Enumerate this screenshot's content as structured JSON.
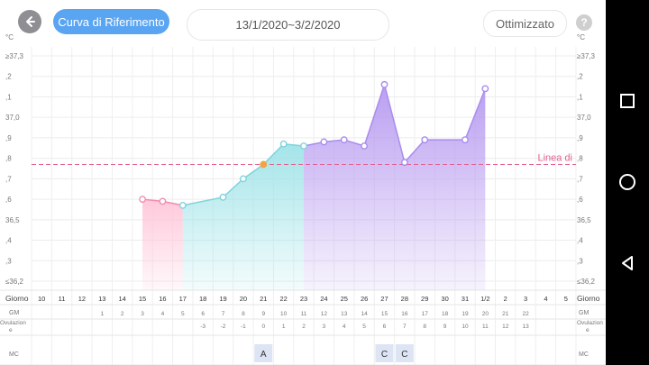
{
  "header": {
    "reference_curve_label": "Curva di Riferimento",
    "date_range": "13/1/2020~3/2/2020",
    "optimized_label": "Ottimizzato",
    "help_label": "?"
  },
  "colors": {
    "accent": "#5aa5f2",
    "follicular_fill": "#9fe3e8",
    "menses_fill": "#ffc6d9",
    "luteal_fill": "#b79af0",
    "coverline": "#e06090",
    "ovulation_point": "#f4a340",
    "marker_badge": "#dde4f3"
  },
  "chart_data": {
    "type": "area",
    "unit_label": "°C",
    "y_tick_labels": [
      "≥37,3",
      ",2",
      ",1",
      "37,0",
      ",9",
      ",8",
      ",7",
      ",6",
      "36,5",
      ",4",
      ",3",
      "≤36,2"
    ],
    "ylim": [
      36.2,
      37.3
    ],
    "coverline_label": "Linea di",
    "coverline_value": 36.77,
    "day_row_label": "Giorno",
    "cycle_day_row_label": "GM",
    "ovulation_row_label": "Ovulazione",
    "mc_row_label": "MC",
    "days": [
      "10",
      "11",
      "12",
      "13",
      "14",
      "15",
      "16",
      "17",
      "18",
      "19",
      "20",
      "21",
      "22",
      "23",
      "24",
      "25",
      "26",
      "27",
      "28",
      "29",
      "30",
      "31",
      "1/2",
      "2",
      "3",
      "4",
      "5"
    ],
    "cycle_days": [
      "",
      "",
      "",
      "1",
      "2",
      "3",
      "4",
      "5",
      "6",
      "7",
      "8",
      "9",
      "10",
      "11",
      "12",
      "13",
      "14",
      "15",
      "16",
      "17",
      "18",
      "19",
      "20",
      "21",
      "22",
      "",
      ""
    ],
    "ovulation_days": [
      "",
      "",
      "",
      "",
      "",
      "",
      "",
      "",
      "-3",
      "-2",
      "-1",
      "0",
      "1",
      "2",
      "3",
      "4",
      "5",
      "6",
      "7",
      "8",
      "9",
      "10",
      "11",
      "12",
      "13",
      "",
      ""
    ],
    "temperatures": [
      null,
      null,
      null,
      null,
      null,
      36.6,
      36.59,
      36.57,
      null,
      36.61,
      36.7,
      36.77,
      36.87,
      36.86,
      36.88,
      36.89,
      36.86,
      37.16,
      36.78,
      36.89,
      null,
      36.89,
      37.14,
      null,
      null,
      null,
      null
    ],
    "ovulation_index": 11,
    "menses_range": [
      5,
      7
    ],
    "follicular_range": [
      7,
      13
    ],
    "luteal_range": [
      13,
      22
    ],
    "mc_markers": [
      {
        "index": 11,
        "label": "A"
      },
      {
        "index": 17,
        "label": "C"
      },
      {
        "index": 18,
        "label": "C"
      }
    ]
  }
}
